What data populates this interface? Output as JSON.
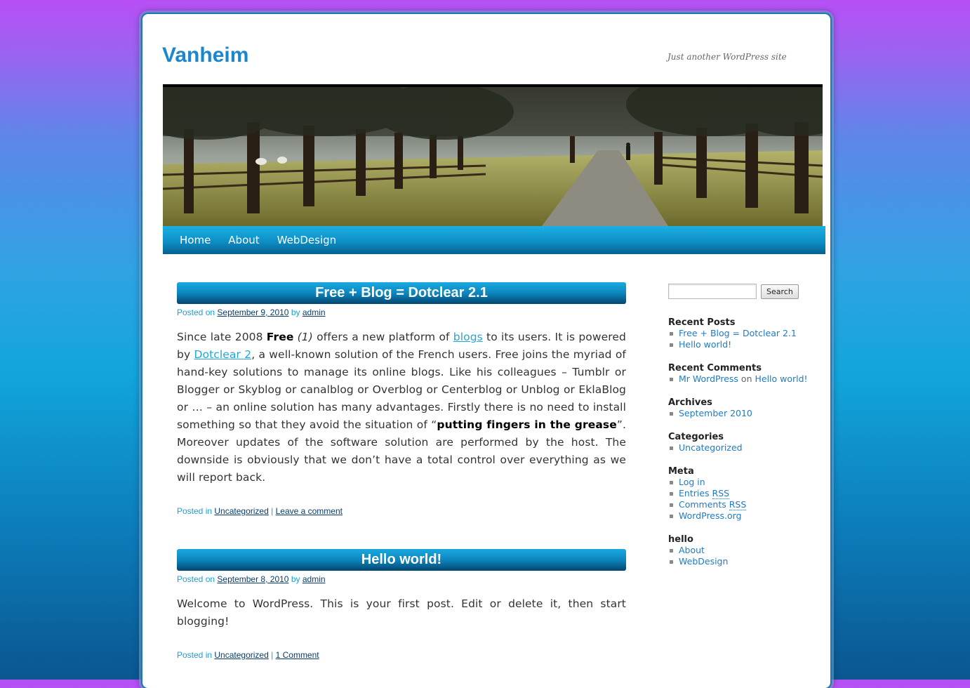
{
  "site": {
    "title": "Vanheim",
    "tagline": "Just another WordPress site"
  },
  "nav": {
    "items": [
      "Home",
      "About",
      "WebDesign"
    ]
  },
  "posts": [
    {
      "title": "Free + Blog = Dotclear 2.1",
      "posted_on": "Posted on",
      "date": "September 9, 2010",
      "by": "by",
      "author": "admin",
      "body": {
        "t1": "Since late 2008 ",
        "b1": "Free",
        "i1": " (1)",
        "t2": " offers a new platform of ",
        "link1": "blogs",
        "t3": " to its users. It is powered by ",
        "link2": "Dotclear 2",
        "t4": ", a well-known solution of the French users. Free joins the myriad of hand-key solutions to manage its online blogs. Like his colleagues – Tumblr or Blogger or Skyblog or canalblog or Overblog or Centerblog or Unblog or EklaBlog or … – an online solution has many advantages. Firstly there is no need to install something so that they avoid the situation of “",
        "b2": "putting fingers in the grease",
        "t5": "”. Moreover updates of the software solution are performed by the host. The downside is obviously that we don’t have a total control over everything as we will report back."
      },
      "posted_in": "Posted in",
      "category": "Uncategorized",
      "separator": "|",
      "comments": "Leave a comment"
    },
    {
      "title": "Hello world!",
      "posted_on": "Posted on",
      "date": "September 8, 2010",
      "by": "by",
      "author": "admin",
      "body_text": "Welcome to WordPress. This is your first post. Edit or delete it, then start blogging!",
      "posted_in": "Posted in",
      "category": "Uncategorized",
      "separator": "|",
      "comments": "1 Comment"
    }
  ],
  "sidebar": {
    "search_button": "Search",
    "search_value": "",
    "recent_posts": {
      "title": "Recent Posts",
      "items": [
        "Free + Blog = Dotclear 2.1",
        "Hello world!"
      ]
    },
    "recent_comments": {
      "title": "Recent Comments",
      "author": "Mr WordPress",
      "on": "on",
      "post": "Hello world!"
    },
    "archives": {
      "title": "Archives",
      "items": [
        "September 2010"
      ]
    },
    "categories": {
      "title": "Categories",
      "items": [
        "Uncategorized"
      ]
    },
    "meta": {
      "title": "Meta",
      "log_in": "Log in",
      "entries": "Entries",
      "comments": "Comments",
      "rss": "RSS",
      "wordpress": "WordPress.org"
    },
    "hello": {
      "title": "hello",
      "items": [
        "About",
        "WebDesign"
      ]
    }
  },
  "colors": {
    "accent": "#1a86cf",
    "link": "#1f7bc4",
    "meta_text": "#1aa0d8"
  }
}
